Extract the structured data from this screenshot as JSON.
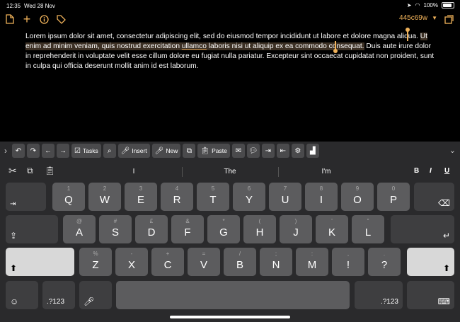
{
  "status": {
    "time": "12:35",
    "date": "Wed 28 Nov",
    "battery": "100%"
  },
  "topbar": {
    "doc_name": "445c69w"
  },
  "text": {
    "before": "Lorem ipsum dolor sit amet, consectetur adipiscing elit, sed do eiusmod tempor incididunt ut labore et dolore magna aliqua. ",
    "sel1": "Ut enim ad minim veniam, quis nostrud exercitation ",
    "sel_ul": "ullamco",
    "sel2": " laboris nisi ut aliquip ex ea commodo consequat.",
    "after": " Duis aute irure dolor in reprehenderit in voluptate velit esse cillum dolore eu fugiat nulla pariatur. Excepteur sint occaecat cupidatat non proident, sunt in culpa qui officia deserunt mollit anim id est laborum."
  },
  "toolbar": {
    "tasks": "Tasks",
    "insert": "Insert",
    "new": "New",
    "paste": "Paste"
  },
  "predict": {
    "w1": "I",
    "w2": "The",
    "w3": "I'm",
    "bold": "B",
    "italic": "I",
    "underline": "U"
  },
  "keys": {
    "row1": [
      {
        "main": "Q",
        "alt": "1"
      },
      {
        "main": "W",
        "alt": "2"
      },
      {
        "main": "E",
        "alt": "3"
      },
      {
        "main": "R",
        "alt": "4"
      },
      {
        "main": "T",
        "alt": "5"
      },
      {
        "main": "Y",
        "alt": "6"
      },
      {
        "main": "U",
        "alt": "7"
      },
      {
        "main": "I",
        "alt": "8"
      },
      {
        "main": "O",
        "alt": "9"
      },
      {
        "main": "P",
        "alt": "0"
      }
    ],
    "row2": [
      {
        "main": "A",
        "alt": "@"
      },
      {
        "main": "S",
        "alt": "#"
      },
      {
        "main": "D",
        "alt": "£"
      },
      {
        "main": "F",
        "alt": "&"
      },
      {
        "main": "G",
        "alt": "*"
      },
      {
        "main": "H",
        "alt": "("
      },
      {
        "main": "J",
        "alt": ")"
      },
      {
        "main": "K",
        "alt": "'"
      },
      {
        "main": "L",
        "alt": "\""
      }
    ],
    "row3": [
      {
        "main": "Z",
        "alt": "%"
      },
      {
        "main": "X",
        "alt": "-"
      },
      {
        "main": "C",
        "alt": "+"
      },
      {
        "main": "V",
        "alt": "="
      },
      {
        "main": "B",
        "alt": "/"
      },
      {
        "main": "N",
        "alt": ";"
      },
      {
        "main": "M",
        "alt": ":"
      },
      {
        "main": "!",
        "alt": ","
      },
      {
        "main": "?",
        "alt": "."
      }
    ],
    "numbers": ".?123"
  }
}
